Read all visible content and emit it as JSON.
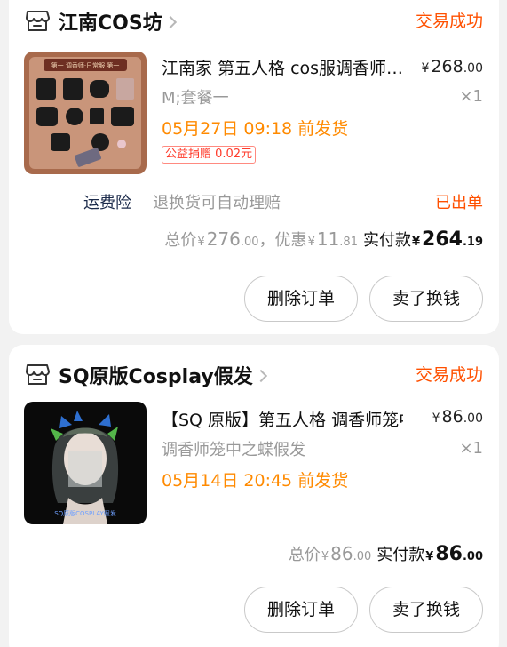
{
  "orders": [
    {
      "shop": {
        "name": "江南COS坊",
        "icon": "shop-icon"
      },
      "status": "交易成功",
      "item": {
        "title": "江南家 第五人格 cos服调香师…",
        "price_symbol": "¥",
        "price_int": "268",
        "price_dec": ".00",
        "sku": "M;套餐一",
        "qty": "×1",
        "ship_time": "05月27日 09:18 前发货",
        "charity": "公益捐赠 0.02元",
        "image": "product-image-costume",
        "image_banner": "第一 调香师·日常服 第一"
      },
      "insurance": {
        "label": "运费险",
        "desc": "退换货可自动理赔",
        "status": "已出单"
      },
      "totals": {
        "total_label": "总价",
        "total_int": "276",
        "total_dec": ".00",
        "discount_label": "，优惠",
        "discount_int": "11",
        "discount_dec": ".81",
        "paid_label": "实付款",
        "paid_int": "264",
        "paid_dec": ".19",
        "currency": "¥"
      },
      "buttons": {
        "delete": "删除订单",
        "resell": "卖了换钱"
      }
    },
    {
      "shop": {
        "name": "SQ原版Cosplay假发",
        "icon": "shop-icon"
      },
      "status": "交易成功",
      "item": {
        "title": "【SQ 原版】第五人格 调香师笼中…",
        "price_symbol": "¥",
        "price_int": "86",
        "price_dec": ".00",
        "sku": "调香师笼中之蝶假发",
        "qty": "×1",
        "ship_time": "05月14日 20:45 前发货",
        "image": "product-image-wig",
        "image_watermark": "SQ原版COSPLAY假发"
      },
      "totals": {
        "total_label": "总价",
        "total_int": "86",
        "total_dec": ".00",
        "paid_label": "实付款",
        "paid_int": "86",
        "paid_dec": ".00",
        "currency": "¥"
      },
      "buttons": {
        "delete": "删除订单",
        "resell": "卖了换钱"
      }
    }
  ]
}
